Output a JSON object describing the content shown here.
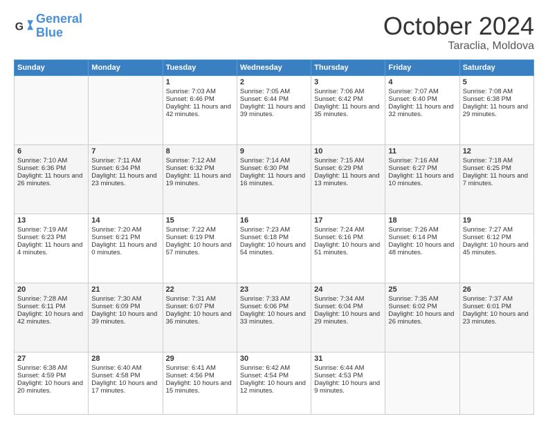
{
  "header": {
    "logo_line1": "General",
    "logo_line2": "Blue",
    "month": "October 2024",
    "location": "Taraclia, Moldova"
  },
  "weekdays": [
    "Sunday",
    "Monday",
    "Tuesday",
    "Wednesday",
    "Thursday",
    "Friday",
    "Saturday"
  ],
  "weeks": [
    [
      {
        "day": "",
        "sunrise": "",
        "sunset": "",
        "daylight": ""
      },
      {
        "day": "",
        "sunrise": "",
        "sunset": "",
        "daylight": ""
      },
      {
        "day": "1",
        "sunrise": "Sunrise: 7:03 AM",
        "sunset": "Sunset: 6:46 PM",
        "daylight": "Daylight: 11 hours and 42 minutes."
      },
      {
        "day": "2",
        "sunrise": "Sunrise: 7:05 AM",
        "sunset": "Sunset: 6:44 PM",
        "daylight": "Daylight: 11 hours and 39 minutes."
      },
      {
        "day": "3",
        "sunrise": "Sunrise: 7:06 AM",
        "sunset": "Sunset: 6:42 PM",
        "daylight": "Daylight: 11 hours and 35 minutes."
      },
      {
        "day": "4",
        "sunrise": "Sunrise: 7:07 AM",
        "sunset": "Sunset: 6:40 PM",
        "daylight": "Daylight: 11 hours and 32 minutes."
      },
      {
        "day": "5",
        "sunrise": "Sunrise: 7:08 AM",
        "sunset": "Sunset: 6:38 PM",
        "daylight": "Daylight: 11 hours and 29 minutes."
      }
    ],
    [
      {
        "day": "6",
        "sunrise": "Sunrise: 7:10 AM",
        "sunset": "Sunset: 6:36 PM",
        "daylight": "Daylight: 11 hours and 26 minutes."
      },
      {
        "day": "7",
        "sunrise": "Sunrise: 7:11 AM",
        "sunset": "Sunset: 6:34 PM",
        "daylight": "Daylight: 11 hours and 23 minutes."
      },
      {
        "day": "8",
        "sunrise": "Sunrise: 7:12 AM",
        "sunset": "Sunset: 6:32 PM",
        "daylight": "Daylight: 11 hours and 19 minutes."
      },
      {
        "day": "9",
        "sunrise": "Sunrise: 7:14 AM",
        "sunset": "Sunset: 6:30 PM",
        "daylight": "Daylight: 11 hours and 16 minutes."
      },
      {
        "day": "10",
        "sunrise": "Sunrise: 7:15 AM",
        "sunset": "Sunset: 6:29 PM",
        "daylight": "Daylight: 11 hours and 13 minutes."
      },
      {
        "day": "11",
        "sunrise": "Sunrise: 7:16 AM",
        "sunset": "Sunset: 6:27 PM",
        "daylight": "Daylight: 11 hours and 10 minutes."
      },
      {
        "day": "12",
        "sunrise": "Sunrise: 7:18 AM",
        "sunset": "Sunset: 6:25 PM",
        "daylight": "Daylight: 11 hours and 7 minutes."
      }
    ],
    [
      {
        "day": "13",
        "sunrise": "Sunrise: 7:19 AM",
        "sunset": "Sunset: 6:23 PM",
        "daylight": "Daylight: 11 hours and 4 minutes."
      },
      {
        "day": "14",
        "sunrise": "Sunrise: 7:20 AM",
        "sunset": "Sunset: 6:21 PM",
        "daylight": "Daylight: 11 hours and 0 minutes."
      },
      {
        "day": "15",
        "sunrise": "Sunrise: 7:22 AM",
        "sunset": "Sunset: 6:19 PM",
        "daylight": "Daylight: 10 hours and 57 minutes."
      },
      {
        "day": "16",
        "sunrise": "Sunrise: 7:23 AM",
        "sunset": "Sunset: 6:18 PM",
        "daylight": "Daylight: 10 hours and 54 minutes."
      },
      {
        "day": "17",
        "sunrise": "Sunrise: 7:24 AM",
        "sunset": "Sunset: 6:16 PM",
        "daylight": "Daylight: 10 hours and 51 minutes."
      },
      {
        "day": "18",
        "sunrise": "Sunrise: 7:26 AM",
        "sunset": "Sunset: 6:14 PM",
        "daylight": "Daylight: 10 hours and 48 minutes."
      },
      {
        "day": "19",
        "sunrise": "Sunrise: 7:27 AM",
        "sunset": "Sunset: 6:12 PM",
        "daylight": "Daylight: 10 hours and 45 minutes."
      }
    ],
    [
      {
        "day": "20",
        "sunrise": "Sunrise: 7:28 AM",
        "sunset": "Sunset: 6:11 PM",
        "daylight": "Daylight: 10 hours and 42 minutes."
      },
      {
        "day": "21",
        "sunrise": "Sunrise: 7:30 AM",
        "sunset": "Sunset: 6:09 PM",
        "daylight": "Daylight: 10 hours and 39 minutes."
      },
      {
        "day": "22",
        "sunrise": "Sunrise: 7:31 AM",
        "sunset": "Sunset: 6:07 PM",
        "daylight": "Daylight: 10 hours and 36 minutes."
      },
      {
        "day": "23",
        "sunrise": "Sunrise: 7:33 AM",
        "sunset": "Sunset: 6:06 PM",
        "daylight": "Daylight: 10 hours and 33 minutes."
      },
      {
        "day": "24",
        "sunrise": "Sunrise: 7:34 AM",
        "sunset": "Sunset: 6:04 PM",
        "daylight": "Daylight: 10 hours and 29 minutes."
      },
      {
        "day": "25",
        "sunrise": "Sunrise: 7:35 AM",
        "sunset": "Sunset: 6:02 PM",
        "daylight": "Daylight: 10 hours and 26 minutes."
      },
      {
        "day": "26",
        "sunrise": "Sunrise: 7:37 AM",
        "sunset": "Sunset: 6:01 PM",
        "daylight": "Daylight: 10 hours and 23 minutes."
      }
    ],
    [
      {
        "day": "27",
        "sunrise": "Sunrise: 6:38 AM",
        "sunset": "Sunset: 4:59 PM",
        "daylight": "Daylight: 10 hours and 20 minutes."
      },
      {
        "day": "28",
        "sunrise": "Sunrise: 6:40 AM",
        "sunset": "Sunset: 4:58 PM",
        "daylight": "Daylight: 10 hours and 17 minutes."
      },
      {
        "day": "29",
        "sunrise": "Sunrise: 6:41 AM",
        "sunset": "Sunset: 4:56 PM",
        "daylight": "Daylight: 10 hours and 15 minutes."
      },
      {
        "day": "30",
        "sunrise": "Sunrise: 6:42 AM",
        "sunset": "Sunset: 4:54 PM",
        "daylight": "Daylight: 10 hours and 12 minutes."
      },
      {
        "day": "31",
        "sunrise": "Sunrise: 6:44 AM",
        "sunset": "Sunset: 4:53 PM",
        "daylight": "Daylight: 10 hours and 9 minutes."
      },
      {
        "day": "",
        "sunrise": "",
        "sunset": "",
        "daylight": ""
      },
      {
        "day": "",
        "sunrise": "",
        "sunset": "",
        "daylight": ""
      }
    ]
  ]
}
